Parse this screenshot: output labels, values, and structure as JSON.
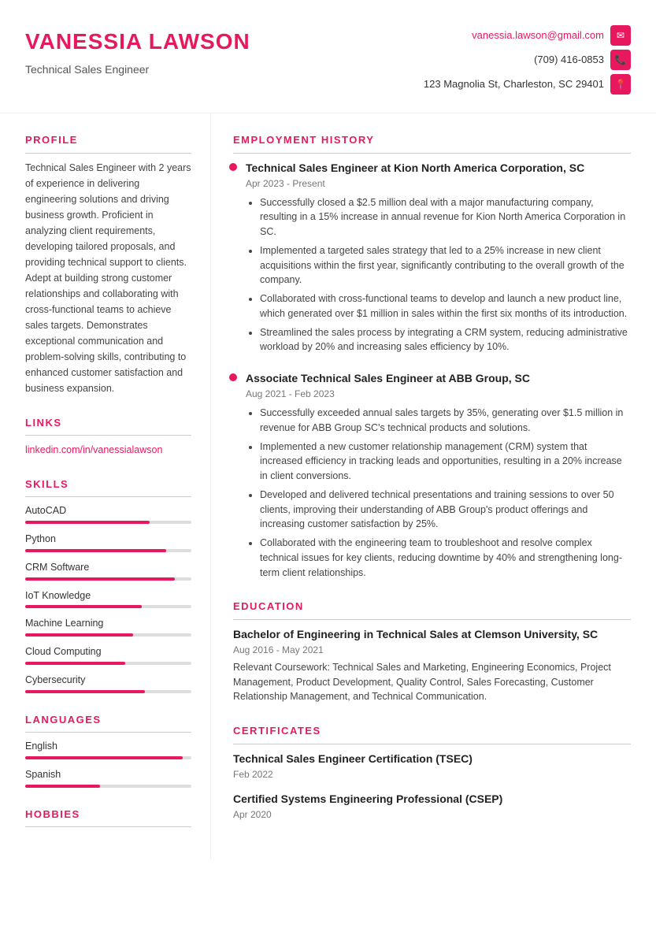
{
  "header": {
    "name": "VANESSIA LAWSON",
    "title": "Technical Sales Engineer",
    "email": "vanessia.lawson@gmail.com",
    "phone": "(709) 416-0853",
    "address": "123 Magnolia St, Charleston, SC 29401"
  },
  "profile": {
    "section_title": "PROFILE",
    "text": "Technical Sales Engineer with 2 years of experience in delivering engineering solutions and driving business growth. Proficient in analyzing client requirements, developing tailored proposals, and providing technical support to clients. Adept at building strong customer relationships and collaborating with cross-functional teams to achieve sales targets. Demonstrates exceptional communication and problem-solving skills, contributing to enhanced customer satisfaction and business expansion."
  },
  "links": {
    "section_title": "LINKS",
    "items": [
      {
        "label": "linkedin.com/in/vanessialawson",
        "url": "#"
      }
    ]
  },
  "skills": {
    "section_title": "SKILLS",
    "items": [
      {
        "name": "AutoCAD",
        "percent": 75
      },
      {
        "name": "Python",
        "percent": 85
      },
      {
        "name": "CRM Software",
        "percent": 90
      },
      {
        "name": "IoT Knowledge",
        "percent": 70
      },
      {
        "name": "Machine Learning",
        "percent": 65
      },
      {
        "name": "Cloud Computing",
        "percent": 60
      },
      {
        "name": "Cybersecurity",
        "percent": 72
      }
    ]
  },
  "languages": {
    "section_title": "LANGUAGES",
    "items": [
      {
        "name": "English",
        "percent": 95
      },
      {
        "name": "Spanish",
        "percent": 45
      }
    ]
  },
  "hobbies": {
    "section_title": "HOBBIES"
  },
  "employment": {
    "section_title": "EMPLOYMENT HISTORY",
    "jobs": [
      {
        "title": "Technical Sales Engineer at Kion North America Corporation, SC",
        "date": "Apr 2023 - Present",
        "bullets": [
          "Successfully closed a $2.5 million deal with a major manufacturing company, resulting in a 15% increase in annual revenue for Kion North America Corporation in SC.",
          "Implemented a targeted sales strategy that led to a 25% increase in new client acquisitions within the first year, significantly contributing to the overall growth of the company.",
          "Collaborated with cross-functional teams to develop and launch a new product line, which generated over $1 million in sales within the first six months of its introduction.",
          "Streamlined the sales process by integrating a CRM system, reducing administrative workload by 20% and increasing sales efficiency by 10%."
        ]
      },
      {
        "title": "Associate Technical Sales Engineer at ABB Group, SC",
        "date": "Aug 2021 - Feb 2023",
        "bullets": [
          "Successfully exceeded annual sales targets by 35%, generating over $1.5 million in revenue for ABB Group SC's technical products and solutions.",
          "Implemented a new customer relationship management (CRM) system that increased efficiency in tracking leads and opportunities, resulting in a 20% increase in client conversions.",
          "Developed and delivered technical presentations and training sessions to over 50 clients, improving their understanding of ABB Group's product offerings and increasing customer satisfaction by 25%.",
          "Collaborated with the engineering team to troubleshoot and resolve complex technical issues for key clients, reducing downtime by 40% and strengthening long-term client relationships."
        ]
      }
    ]
  },
  "education": {
    "section_title": "EDUCATION",
    "items": [
      {
        "title": "Bachelor of Engineering in Technical Sales at Clemson University, SC",
        "date": "Aug 2016 - May 2021",
        "description": "Relevant Coursework: Technical Sales and Marketing, Engineering Economics, Project Management, Product Development, Quality Control, Sales Forecasting, Customer Relationship Management, and Technical Communication."
      }
    ]
  },
  "certificates": {
    "section_title": "CERTIFICATES",
    "items": [
      {
        "title": "Technical Sales Engineer Certification (TSEC)",
        "date": "Feb 2022"
      },
      {
        "title": "Certified Systems Engineering Professional (CSEP)",
        "date": "Apr 2020"
      }
    ]
  }
}
